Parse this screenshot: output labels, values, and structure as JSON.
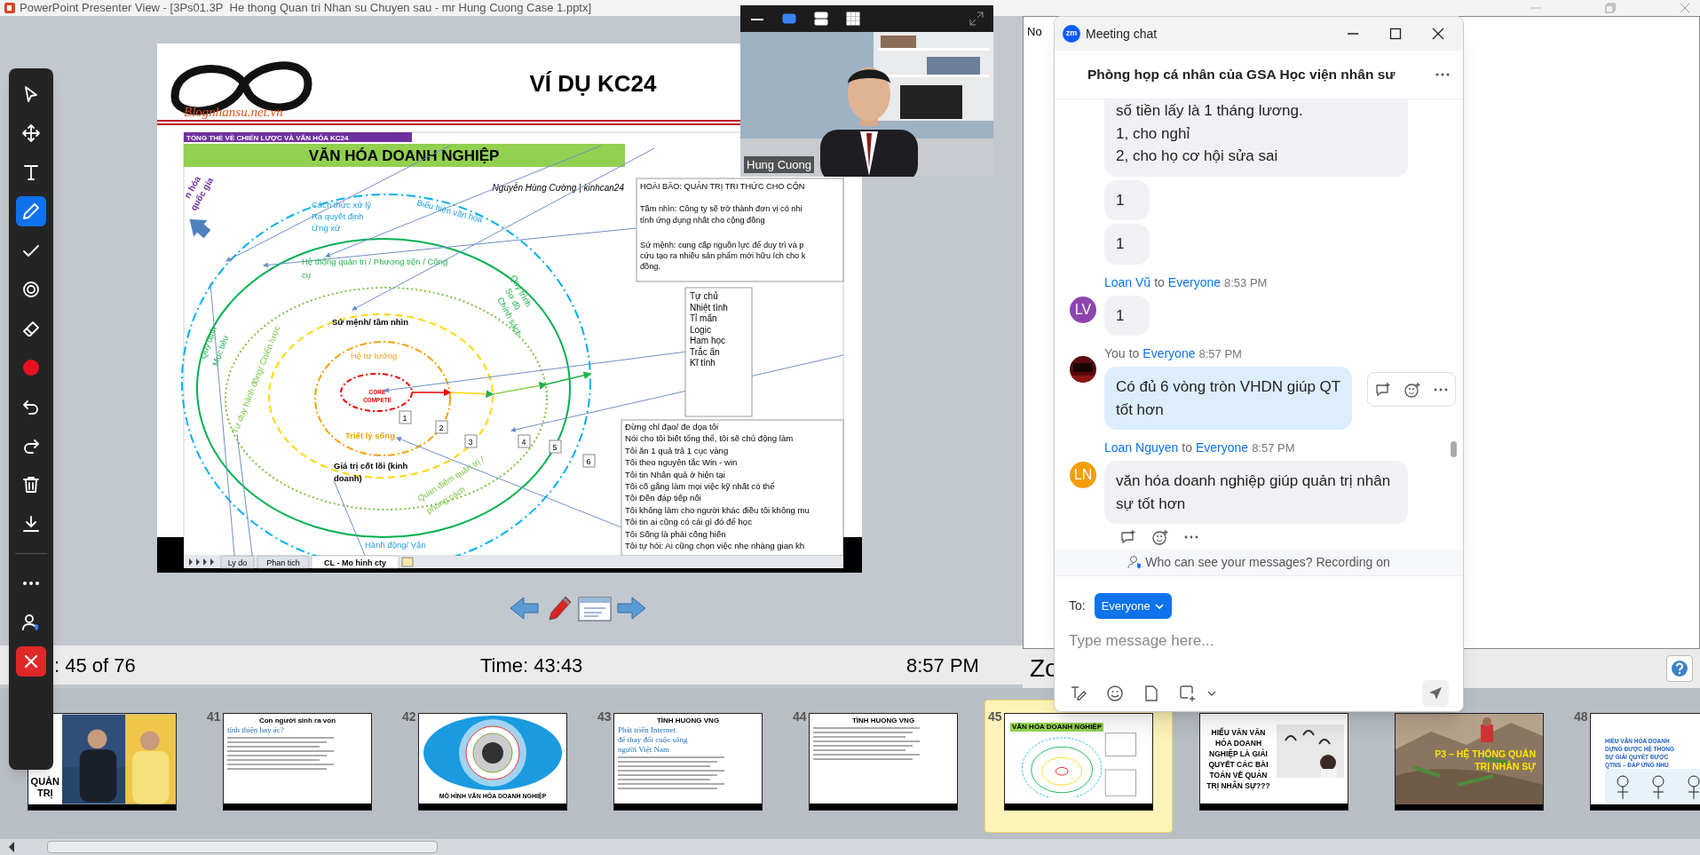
{
  "window": {
    "title": "PowerPoint Presenter View - [3Ps01.3P  He thong Quan tri Nhan su Chuyen sau - mr Hung Cuong Case 1.pptx]"
  },
  "slide": {
    "logo": "Blognhansu.net.vn",
    "title": "VÍ DỤ KC24",
    "section_bar": "TỔNG THỂ VỀ CHIẾN LƯỢC VÀ VĂN HÓA KC24",
    "heading": "VĂN HÓA DOANH NGHIỆP",
    "author": "Nguyễn Hùng Cường | kinhcan24",
    "diagram_labels": [
      "n hóa",
      "quốc gia",
      "Cách thức xử lý",
      "Ra quyết định",
      "Ứng xử",
      "Biểu hiện văn hóa",
      "Hệ thống quản trị / Phương tiện / Công",
      "cụ",
      "Sứ mệnh/ tầm nhìn",
      "Hệ tư tưởng",
      "CORE",
      "COMPETE",
      "Triết lý sống",
      "Giá trị cốt lõi (kinh",
      "doanh)",
      "Quan điểm quản trị /",
      "phong  cách",
      "Hành động/ Vận",
      "Quy trình",
      "Sơ đồ",
      "Chính sách",
      "Quy định",
      "Mục tiêu",
      "Tư duy hành động/ Chiến lược"
    ],
    "ring_numbers": [
      "1",
      "2",
      "3",
      "4",
      "5",
      "6"
    ],
    "vision_box": [
      "HOÀI BÃO: QUẢN TRỊ TRI THỨC CHO CỘN",
      "Tầm nhìn: Công ty sẽ trở thành đơn vị có nhi",
      "tính ứng dụng nhất cho cộng đồng",
      "Sứ mệnh: cung cấp nguồn lực để duy trì và p",
      "cứu tạo ra nhiều sản phẩm mới hữu ích cho k",
      "đồng."
    ],
    "traits": [
      "Tự chủ",
      "Nhiệt tình",
      "Tỉ mẩn",
      "Logic",
      "Ham học",
      "Trắc ẩn",
      "Kĩ tính"
    ],
    "beliefs": [
      "Đừng chỉ đạo/ đe dọa tôi",
      "Nói cho tôi biết tổng thể, tôi sẽ chủ động làm",
      "Tôi ăn 1 quả trả 1 cục vàng",
      "Tôi theo nguyên tắc Win - win",
      "Tôi tin Nhân quả ở hiện tại",
      "Tôi cố gắng làm mọi việc kỹ nhất có thể",
      "Tôi Đền đáp tiếp nối",
      "Tôi không làm cho người khác điều tôi không mu",
      "Tôi tin ai cũng có cái gì đó để học",
      "Tôi Sống là phải cống hiến",
      "Tôi tự hỏi: Ai cũng chọn việc nhẹ nhàng gian kh"
    ],
    "sheet_tabs": [
      {
        "label": "Ly do",
        "selected": false
      },
      {
        "label": "Phan tich",
        "selected": false
      },
      {
        "label": "CL - Mo hinh cty",
        "selected": true
      }
    ]
  },
  "video": {
    "name": "Hung Cuong",
    "layouts": [
      {
        "kind": "minimize",
        "selected": false
      },
      {
        "kind": "speaker",
        "selected": true
      },
      {
        "kind": "stacked",
        "selected": false
      },
      {
        "kind": "gallery",
        "selected": false
      }
    ]
  },
  "annotation_tools": [
    {
      "kind": "select",
      "selected": false
    },
    {
      "kind": "move",
      "selected": false
    },
    {
      "kind": "text",
      "selected": false
    },
    {
      "kind": "pen",
      "selected": true
    },
    {
      "kind": "stamp",
      "selected": false
    },
    {
      "kind": "spotlight",
      "selected": false
    },
    {
      "kind": "eraser",
      "selected": false
    },
    {
      "kind": "color",
      "selected": false,
      "color": "#e81123"
    },
    {
      "kind": "undo",
      "selected": false
    },
    {
      "kind": "redo",
      "selected": false
    },
    {
      "kind": "clear",
      "selected": false
    },
    {
      "kind": "save",
      "selected": false
    },
    {
      "kind": "more",
      "selected": false
    },
    {
      "kind": "participants",
      "selected": false
    },
    {
      "kind": "stop",
      "selected": false
    }
  ],
  "status": {
    "slide_counter": ": 45 of 76",
    "time": "Time: 43:43",
    "clock": "8:57 PM"
  },
  "notes": {
    "text": "No",
    "zoom_label": "Zo"
  },
  "chat": {
    "logo": "zm",
    "title": "Meeting chat",
    "room": "Phòng họp cá nhân của GSA Học viện nhân sư",
    "messages": [
      {
        "kind": "continued",
        "lines": [
          "số tiền lấy là 1 tháng lương.",
          "1, cho nghỉ",
          "2, cho họ cơ hội sửa sai"
        ]
      },
      {
        "kind": "continued",
        "lines": [
          "1"
        ]
      },
      {
        "kind": "continued",
        "lines": [
          "1"
        ]
      },
      {
        "kind": "new",
        "sender": "Loan Vũ",
        "to_word": "to",
        "recipient": "Everyone",
        "time": "8:53 PM",
        "initials": "LV",
        "color": "#8e44ad",
        "lines": [
          "1"
        ]
      },
      {
        "kind": "own",
        "sender": "You",
        "to_word": "to",
        "recipient": "Everyone",
        "time": "8:57 PM",
        "lines": [
          "Có đủ 6 vòng tròn VHDN giúp QT",
          "tốt hơn"
        ]
      },
      {
        "kind": "new",
        "sender": "Loan Nguyen",
        "to_word": "to",
        "recipient": "Everyone",
        "time": "8:57 PM",
        "initials": "LN",
        "color": "#f59e0b",
        "lines": [
          "văn hóa doanh nghiệp giúp quản trị nhân sự tốt hơn"
        ]
      }
    ],
    "privacy": "Who can see your messages? Recording on",
    "to_label": "To:",
    "recipient_button": "Everyone",
    "placeholder": "Type message here..."
  },
  "thumbnails": [
    {
      "selected": false,
      "lines": [
        "QUẢN",
        "TRỊ"
      ]
    },
    {
      "kind": "text",
      "number": "41",
      "selected": false,
      "lines": [
        "Con người sinh ra vốn",
        "tính thiện hay ác?"
      ]
    },
    {
      "kind": "diagram",
      "number": "42",
      "selected": false,
      "lines": [
        "MÔ HÌNH VĂN HÓA DOANH NGHIỆP"
      ]
    },
    {
      "kind": "text",
      "number": "43",
      "selected": false,
      "lines": [
        "TÌNH HUỐNG VNG",
        "Phát triển Internet",
        "để thay đổi cuộc sống",
        "người Việt Nam"
      ]
    },
    {
      "kind": "text",
      "number": "44",
      "selected": false,
      "lines": [
        "TÌNH HUỐNG VNG"
      ]
    },
    {
      "kind": "mini",
      "number": "45",
      "selected": true,
      "lines": [
        "VĂN HÓA DOANH NGHIỆP"
      ]
    },
    {
      "kind": "question",
      "selected": false,
      "lines": [
        "HIỂU VĂN VĂN",
        "HÓA DOANH",
        "NGHIỆP LÀ GIẢI",
        "QUYẾT CÁC BÀI",
        "TOÁN VỀ QUẢN",
        "TRỊ NHÂN SỰ???"
      ]
    },
    {
      "kind": "landscape",
      "selected": false,
      "lines": [
        "P3 – HỆ THỐNG QUẢN",
        "TRỊ NHÂN SỰ"
      ]
    },
    {
      "kind": "banner",
      "number": "48",
      "selected": false,
      "lines": [
        "HIỂU VĂN HÓA DOANH",
        "DỰNG ĐƯỢC HỆ THỐNG",
        "SỰ GIẢI QUYẾT ĐƯỢC",
        "QTNS – ĐÁP ỨNG NHU"
      ]
    }
  ]
}
